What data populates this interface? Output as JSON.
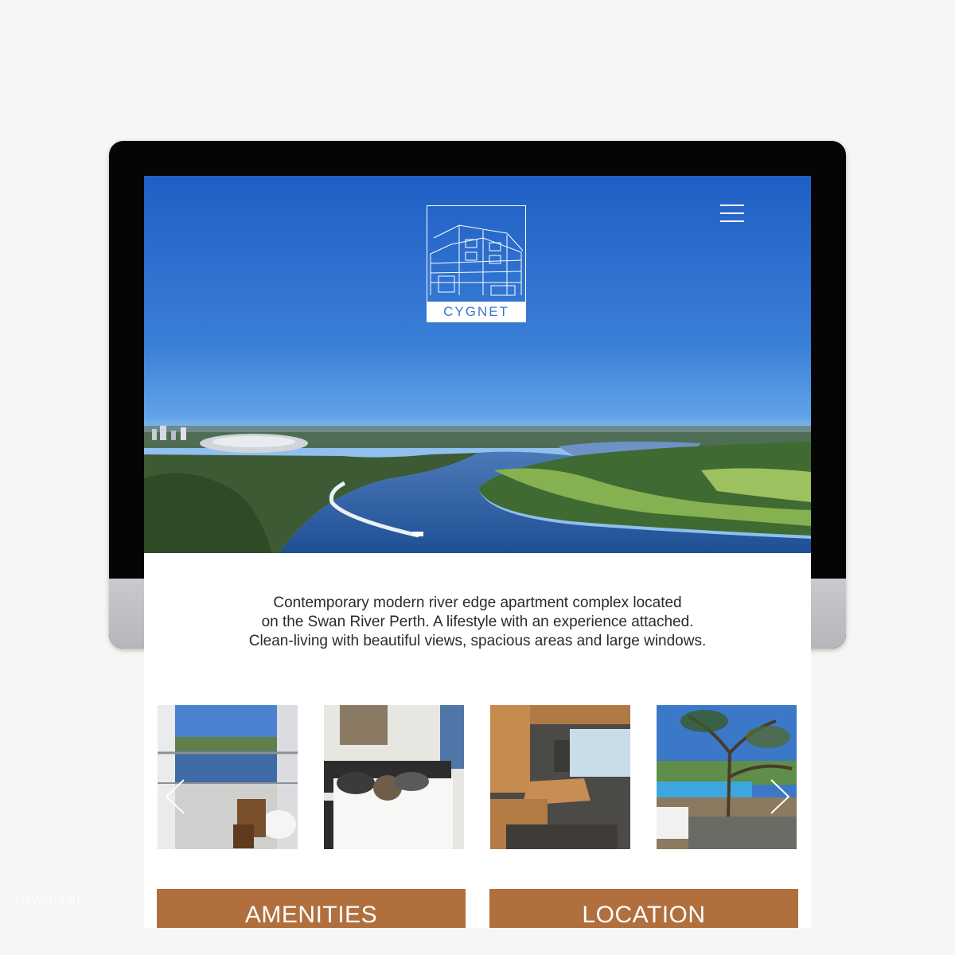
{
  "logo": {
    "wordmark": "CYGNET"
  },
  "intro": {
    "lines": [
      "Contemporary modern river edge apartment complex located",
      "on the Swan River Perth. A lifestyle with an experience attached.",
      "Clean-living with beautiful views, spacious areas and large windows."
    ]
  },
  "gallery": {
    "images": [
      "balcony-river-view",
      "bedroom",
      "dining-area",
      "pool-terrace"
    ]
  },
  "buttons": {
    "amenities": "AMENITIES",
    "location": "LOCATION"
  },
  "colors": {
    "accent": "#b06f3d",
    "logo_text": "#3a78cc",
    "sky": "#2b6fd0"
  },
  "icons": {
    "menu": "hamburger-menu-icon",
    "prev": "chevron-left-icon",
    "next": "chevron-right-icon"
  },
  "watermark": "rawpixel"
}
